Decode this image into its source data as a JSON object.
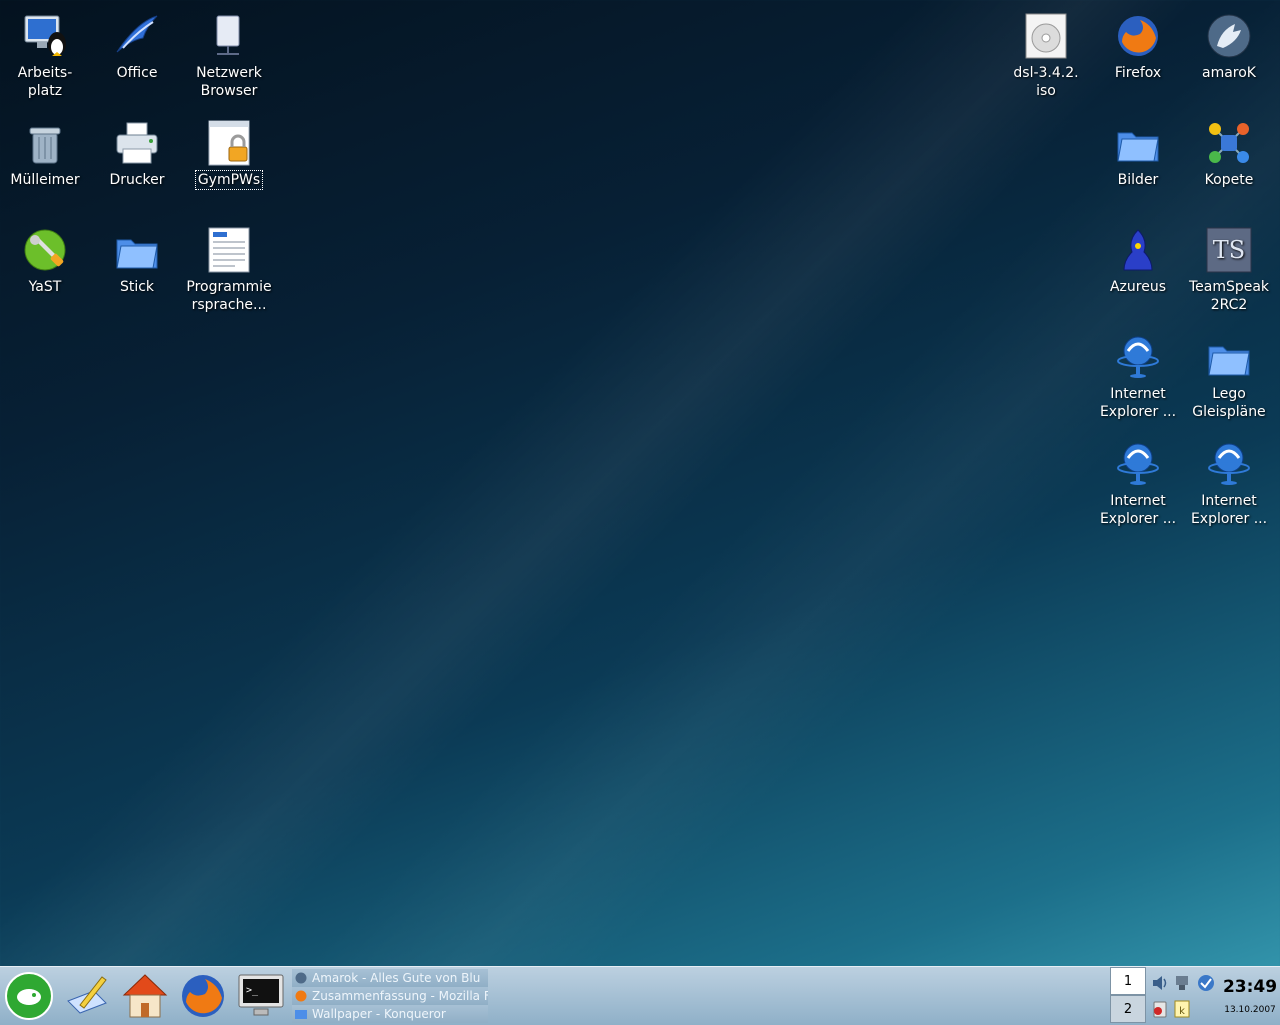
{
  "desktop": {
    "icons": [
      {
        "label": "Arbeits-platz",
        "icon": "computer-icon"
      },
      {
        "label": "Office",
        "icon": "office-icon"
      },
      {
        "label": "Netzwerk Browser",
        "icon": "network-icon"
      },
      {
        "label": "Mülleimer",
        "icon": "trash-icon"
      },
      {
        "label": "Drucker",
        "icon": "printer-icon"
      },
      {
        "label": "GymPWs",
        "icon": "locked-file-icon"
      },
      {
        "label": "YaST",
        "icon": "yast-icon"
      },
      {
        "label": "Stick",
        "icon": "folder-icon"
      },
      {
        "label": "Programmie rsprache...",
        "icon": "document-icon"
      },
      {
        "label": "dsl-3.4.2. iso",
        "icon": "disc-image-icon"
      },
      {
        "label": "Firefox",
        "icon": "firefox-icon"
      },
      {
        "label": "amaroK",
        "icon": "amarok-icon"
      },
      {
        "label": "Bilder",
        "icon": "folder-icon"
      },
      {
        "label": "Kopete",
        "icon": "kopete-icon"
      },
      {
        "label": "Azureus",
        "icon": "azureus-icon"
      },
      {
        "label": "TeamSpeak 2RC2",
        "icon": "teamspeak-icon"
      },
      {
        "label": "Internet Explorer ...",
        "icon": "ie-icon"
      },
      {
        "label": "Lego Gleispläne",
        "icon": "folder-icon"
      },
      {
        "label": "Internet Explorer ...",
        "icon": "ie-icon"
      },
      {
        "label": "Internet Explorer ...",
        "icon": "ie-icon"
      }
    ]
  },
  "taskbar": {
    "launchers": [
      "suse-menu-icon",
      "kwrite-icon",
      "home-icon",
      "firefox-icon",
      "terminal-icon"
    ],
    "tasks": [
      {
        "label": "Amarok - Alles Gute von Blu",
        "icon": "amarok-icon"
      },
      {
        "label": "Zusammenfassung - Mozilla F",
        "icon": "firefox-icon"
      },
      {
        "label": "Wallpaper - Konqueror",
        "icon": "folder-icon"
      }
    ],
    "pager": [
      "1",
      "2"
    ],
    "tray": [
      "volume-icon",
      "network-tray-icon",
      "update-icon",
      "klipper-icon",
      "knotes-icon"
    ],
    "clock": {
      "time": "23:49",
      "date": "13.10.2007"
    }
  },
  "colors": {
    "wallpaper_dark": "#04121f",
    "wallpaper_light": "#3aa0b6",
    "taskbar": "#8fb0c8"
  }
}
